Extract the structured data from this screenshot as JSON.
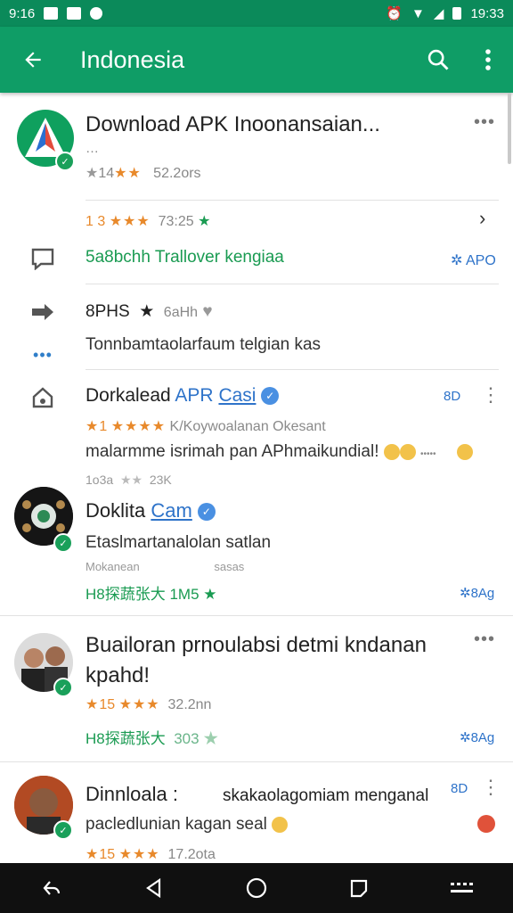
{
  "status_bar": {
    "time_left": "9:16",
    "time_right": "19:33"
  },
  "app_bar": {
    "title": "Indonesia"
  },
  "app_card": {
    "title": "Download APK Inoonansaian...",
    "subtitle": "…",
    "rating_prefix": "14",
    "rating_stars": "★★",
    "reviews": "52.2ors",
    "line2_rating": "1 3",
    "line2_stars": "★★★",
    "line2_value": "73:25",
    "line3_text": "5a8bchh Trallover kengiaa",
    "line3_tag": "APO",
    "line4_name": "8PHS",
    "line4_meta": "6aHh",
    "line5_text": "Tonnbamtaolarfaum telgian kas"
  },
  "posts": [
    {
      "name": "Dorkalead",
      "name_suffix": "APR",
      "link": "Casi",
      "rating_prefix": "1",
      "stars": "★★★★",
      "meta_text": "K/Koywoalanan Okesant",
      "body": "malarmme isrimah pan APhmaikundial!",
      "footer": "1o3a",
      "footer2": "23K",
      "tag": "8D"
    },
    {
      "name": "Doklita",
      "link": "Cam",
      "body": "Etaslmartanalolan satlan",
      "meta_text": "Mokanean",
      "meta2": "sasas",
      "green_text": "H8探蔬张大",
      "green_val": "1M5",
      "tag": "8Ag"
    },
    {
      "name": "Buailoran prnoulabsi detmi kndanan",
      "name2": "kpahd!",
      "rating_prefix": "15",
      "stars": "★★★",
      "value": "32.2nn",
      "green_text": "H8探蔬张大",
      "green_val": "303",
      "tag": "8Ag"
    },
    {
      "name": "Dinnloala :",
      "body_right": "skakaolagomiam menganal",
      "body": "pacledlunian kagan seal",
      "rating_prefix": "15",
      "stars": "★★★",
      "value": "17.2ota",
      "tag": "8D"
    }
  ]
}
